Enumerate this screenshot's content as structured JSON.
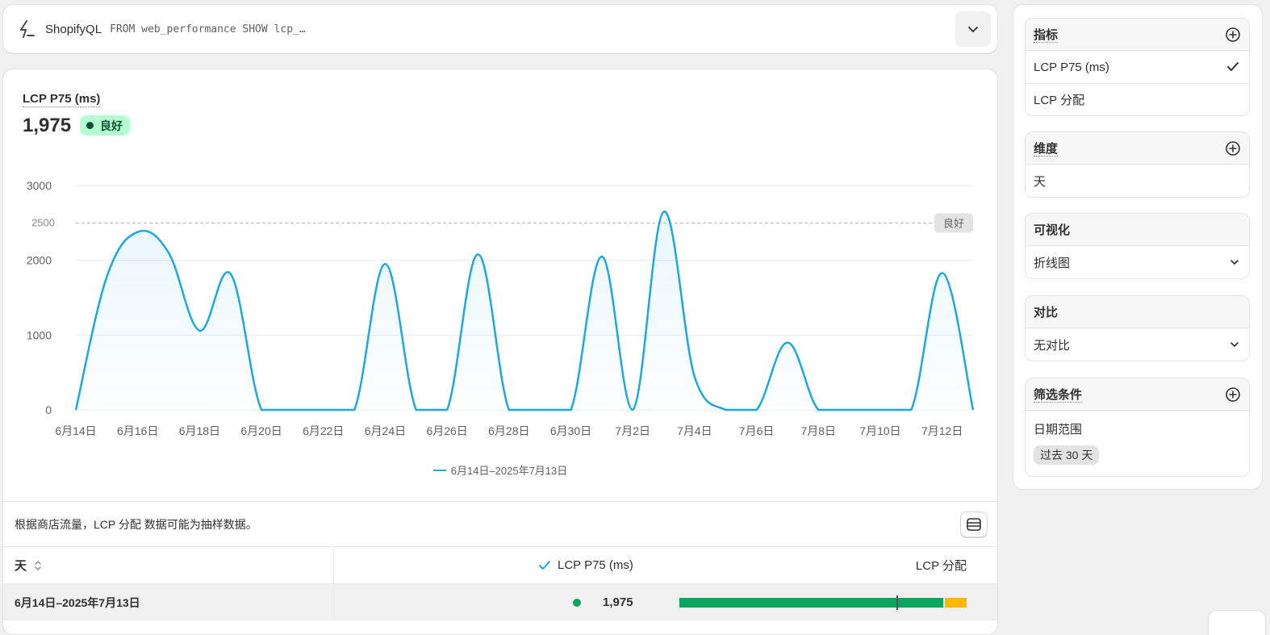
{
  "query_bar": {
    "brand": "ShopifyQL",
    "query": "FROM web_performance SHOW lcp_…",
    "icons": {
      "brand": "bolt-icon",
      "expand": "chevron-down-icon"
    }
  },
  "metric": {
    "title": "LCP P75 (ms)",
    "value": "1,975",
    "status": "良好",
    "status_color": "#b4fed2"
  },
  "chart_data": {
    "type": "line",
    "x": [
      "6月14日",
      "6月15日",
      "6月16日",
      "6月17日",
      "6月18日",
      "6月19日",
      "6月20日",
      "6月21日",
      "6月22日",
      "6月23日",
      "6月24日",
      "6月25日",
      "6月26日",
      "6月27日",
      "6月28日",
      "6月29日",
      "6月30日",
      "7月1日",
      "7月2日",
      "7月3日",
      "7月4日",
      "7月5日",
      "7月6日",
      "7月7日",
      "7月8日",
      "7月9日",
      "7月10日",
      "7月11日",
      "7月12日",
      "7月13日"
    ],
    "x_tick_labels": [
      "6月14日",
      "6月16日",
      "6月18日",
      "6月20日",
      "6月22日",
      "6月24日",
      "6月26日",
      "6月28日",
      "6月30日",
      "7月2日",
      "7月4日",
      "7月6日",
      "7月8日",
      "7月10日",
      "7月12日"
    ],
    "series": [
      {
        "name": "6月14日–2025年7月13日",
        "color": "#1ca8e0",
        "values": [
          0,
          1780,
          2380,
          2100,
          1060,
          1820,
          0,
          0,
          0,
          0,
          1950,
          0,
          0,
          2080,
          0,
          0,
          0,
          2050,
          0,
          2650,
          440,
          0,
          0,
          900,
          0,
          0,
          0,
          0,
          1830,
          0
        ]
      }
    ],
    "y_ticks": [
      0,
      1000,
      2000,
      3000
    ],
    "ylim": [
      0,
      3000
    ],
    "threshold": {
      "value": 2500,
      "label": "良好",
      "tick_label": "2500"
    },
    "grid": true,
    "legend_position": "bottom"
  },
  "note": {
    "text": "根据商店流量，LCP 分配 数据可能为抽样数据。",
    "icon": "table-view-icon"
  },
  "table": {
    "headers": {
      "day": "天",
      "lcp": "LCP P75 (ms)",
      "distribution": "LCP 分配"
    },
    "rows": [
      {
        "day": "6月14日–2025年7月13日",
        "lcp": "1,975",
        "status_color": "#0aa55e",
        "distribution": {
          "good": 0.925,
          "needs_improvement": 0.075,
          "marker": 0.755
        }
      }
    ]
  },
  "side_panel": {
    "metrics": {
      "title": "指标",
      "items": [
        {
          "label": "LCP P75 (ms)",
          "selected": true
        },
        {
          "label": "LCP 分配",
          "selected": false
        }
      ]
    },
    "dimensions": {
      "title": "维度",
      "items": [
        {
          "label": "天"
        }
      ]
    },
    "visualization": {
      "title": "可视化",
      "value": "折线图"
    },
    "comparison": {
      "title": "对比",
      "value": "无对比"
    },
    "filters": {
      "title": "筛选条件",
      "items": [
        {
          "label": "日期范围",
          "chip": "过去 30 天"
        }
      ]
    }
  }
}
